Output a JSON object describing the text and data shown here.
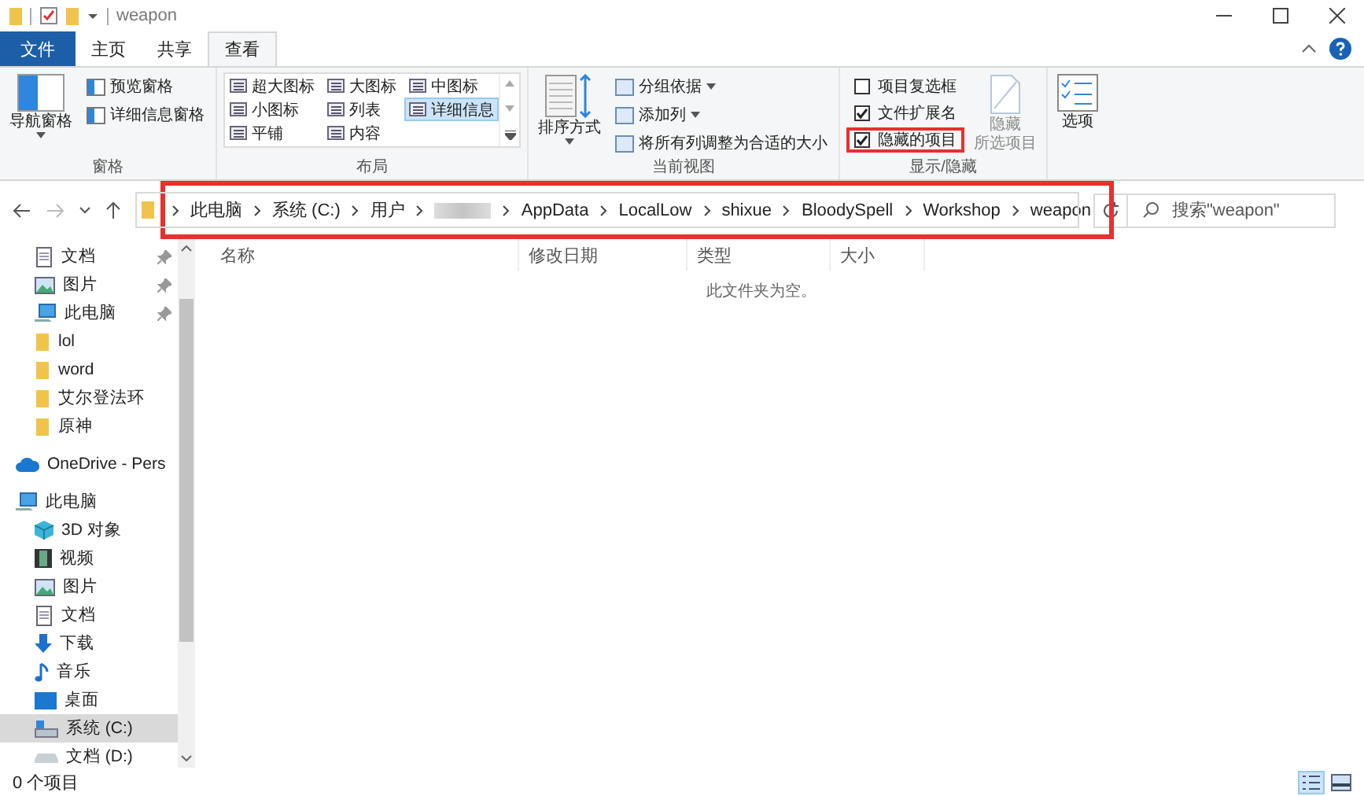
{
  "window": {
    "title": "weapon"
  },
  "tabs": [
    {
      "label": "文件",
      "kind": "file",
      "selected": false
    },
    {
      "label": "主页",
      "kind": "tab",
      "selected": false
    },
    {
      "label": "共享",
      "kind": "tab",
      "selected": false
    },
    {
      "label": "查看",
      "kind": "tab",
      "selected": true
    }
  ],
  "ribbon": {
    "panes": {
      "label": "窗格",
      "nav": "导航窗格",
      "items": [
        "预览窗格",
        "详细信息窗格"
      ]
    },
    "layout": {
      "label": "布局",
      "items": [
        {
          "label": "超大图标",
          "selected": false
        },
        {
          "label": "大图标",
          "selected": false
        },
        {
          "label": "中图标",
          "selected": false
        },
        {
          "label": "小图标",
          "selected": false
        },
        {
          "label": "列表",
          "selected": false
        },
        {
          "label": "详细信息",
          "selected": true
        },
        {
          "label": "平铺",
          "selected": false
        },
        {
          "label": "内容",
          "selected": false
        }
      ]
    },
    "current_view": {
      "label": "当前视图",
      "sort": "排序方式",
      "items": [
        {
          "label": "分组依据",
          "dropdown": true
        },
        {
          "label": "添加列",
          "dropdown": true
        },
        {
          "label": "将所有列调整为合适的大小",
          "dropdown": false
        }
      ]
    },
    "show_hide": {
      "label": "显示/隐藏",
      "checkboxes": [
        {
          "label": "项目复选框",
          "checked": false,
          "highlighted": false
        },
        {
          "label": "文件扩展名",
          "checked": true,
          "highlighted": false
        },
        {
          "label": "隐藏的项目",
          "checked": true,
          "highlighted": true
        }
      ],
      "hide_selected": {
        "lines": [
          "隐藏",
          "所选项目"
        ],
        "disabled": true
      }
    },
    "options": "选项"
  },
  "address_bar": {
    "highlighted": true,
    "crumbs": [
      {
        "kind": "text",
        "label": "此电脑"
      },
      {
        "kind": "text",
        "label": "系统 (C:)"
      },
      {
        "kind": "text",
        "label": "用户"
      },
      {
        "kind": "redacted"
      },
      {
        "kind": "text",
        "label": "AppData"
      },
      {
        "kind": "text",
        "label": "LocalLow"
      },
      {
        "kind": "text",
        "label": "shixue"
      },
      {
        "kind": "text",
        "label": "BloodySpell"
      },
      {
        "kind": "text",
        "label": "Workshop"
      },
      {
        "kind": "text",
        "label": "weapon"
      }
    ]
  },
  "search": {
    "placeholder": "搜索\"weapon\""
  },
  "sidebar": {
    "sections": [
      {
        "items": [
          {
            "label": "文档",
            "kind": "document",
            "pinned": true,
            "selected": false
          },
          {
            "label": "图片",
            "kind": "picture",
            "pinned": true,
            "selected": false
          },
          {
            "label": "此电脑",
            "kind": "pc",
            "pinned": true,
            "selected": false
          },
          {
            "label": "lol",
            "kind": "folder",
            "pinned": false,
            "selected": false
          },
          {
            "label": "word",
            "kind": "folder",
            "pinned": false,
            "selected": false
          },
          {
            "label": "艾尔登法环",
            "kind": "folder",
            "pinned": false,
            "selected": false
          },
          {
            "label": "原神",
            "kind": "folder",
            "pinned": false,
            "selected": false
          }
        ]
      },
      {
        "items": [
          {
            "label": "OneDrive - Pers",
            "kind": "cloud",
            "pinned": false,
            "selected": false
          }
        ]
      },
      {
        "items": [
          {
            "label": "此电脑",
            "kind": "pc",
            "pinned": false,
            "selected": false,
            "children": [
              {
                "label": "3D 对象",
                "kind": "cube",
                "pinned": false,
                "selected": false
              },
              {
                "label": "视频",
                "kind": "video",
                "pinned": false,
                "selected": false
              },
              {
                "label": "图片",
                "kind": "picture",
                "pinned": false,
                "selected": false
              },
              {
                "label": "文档",
                "kind": "document",
                "pinned": false,
                "selected": false
              },
              {
                "label": "下载",
                "kind": "download",
                "pinned": false,
                "selected": false
              },
              {
                "label": "音乐",
                "kind": "music",
                "pinned": false,
                "selected": false
              },
              {
                "label": "桌面",
                "kind": "desktop",
                "pinned": false,
                "selected": false
              },
              {
                "label": "系统 (C:)",
                "kind": "drive",
                "pinned": false,
                "selected": true
              },
              {
                "label": "文档 (D:)",
                "kind": "disk",
                "pinned": false,
                "selected": false
              }
            ]
          }
        ]
      }
    ]
  },
  "file_list": {
    "columns": [
      "名称",
      "修改日期",
      "类型",
      "大小"
    ],
    "empty_message": "此文件夹为空。"
  },
  "status_bar": {
    "text": "0 个项目",
    "views": [
      {
        "kind": "details",
        "selected": true
      },
      {
        "kind": "large-icons",
        "selected": false
      }
    ]
  }
}
